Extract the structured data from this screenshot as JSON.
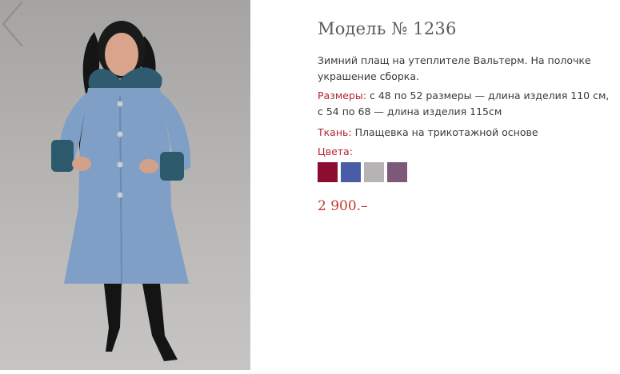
{
  "product": {
    "title": "Модель № 1236",
    "description": "Зимний плащ на утеплителе Вальтерм. На полочке украшение сборка.",
    "sizes_label": "Размеры:",
    "sizes_value": "с 48 по 52 размеры — длина изделия 110 см, с 54 по 68 — длина изделия 115см",
    "fabric_label": "Ткань:",
    "fabric_value": "Плащевка на трикотажной основе",
    "colors_label": "Цвета:",
    "colors": [
      "#8b0d2f",
      "#4a5ba8",
      "#b5b3b4",
      "#7d5879"
    ],
    "price": "2 900.–"
  },
  "icons": {
    "prev": "chevron-left-icon"
  },
  "accent_color": "#b3262d"
}
